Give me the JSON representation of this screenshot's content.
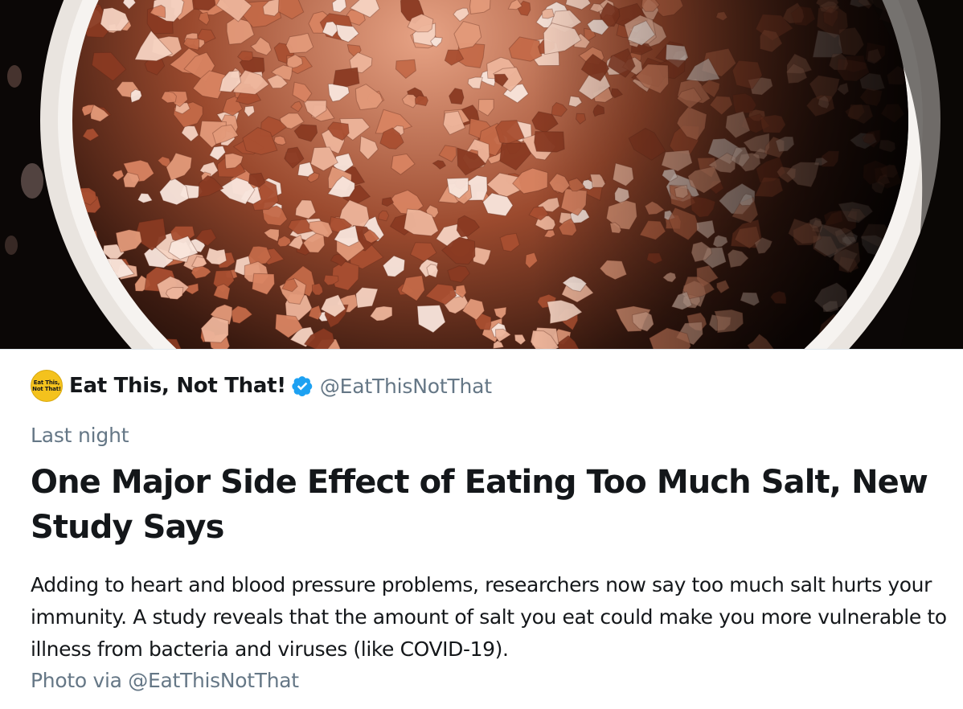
{
  "hero_image": {
    "icon": "pink-himalayan-salt-bowl-photo",
    "colors": {
      "background": "#0b0706",
      "bowl_rim": "#f2efec",
      "salt_light": "#f6d3c2",
      "salt_mid": "#d98462",
      "salt_dark": "#8a3a22",
      "shadow": "#1a0d09"
    }
  },
  "account": {
    "avatar": {
      "icon": "eat-this-not-that-logo",
      "line1": "Eat This,",
      "line2": "Not That!",
      "color": "#f4c21d"
    },
    "name": "Eat This, Not That!",
    "verified_icon": "verified-badge-icon",
    "verified_color": "#1da1f2",
    "handle": "@EatThisNotThat"
  },
  "timestamp": "Last night",
  "headline": "One Major Side Effect of Eating Too Much Salt, New Study Says",
  "description": "Adding to heart and blood pressure problems, researchers now say too much salt hurts your immunity. A study reveals that the amount of salt you eat could make you more vulnerable to illness from bacteria and viruses (like COVID-19).",
  "photo_credit": "Photo via @EatThisNotThat",
  "colors": {
    "text_primary": "#14171a",
    "text_secondary": "#657786",
    "divider": "#e1e8ed"
  }
}
